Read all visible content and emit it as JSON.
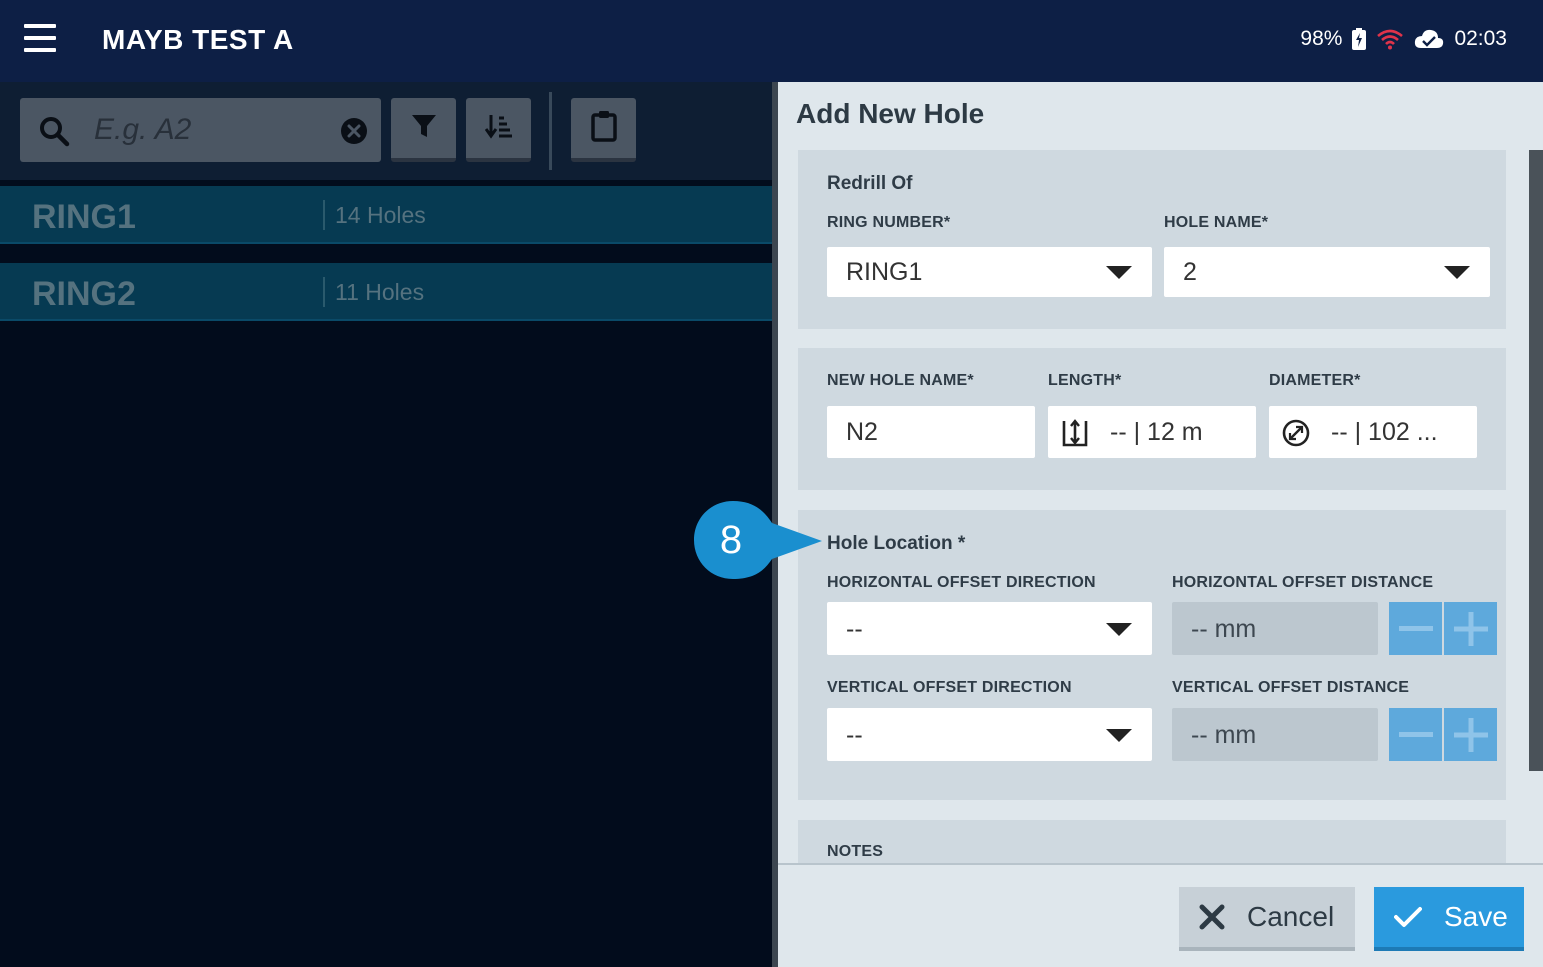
{
  "header": {
    "title": "MAYB TEST A",
    "battery": "98%",
    "time": "02:03"
  },
  "search": {
    "placeholder": "E.g. A2"
  },
  "rings": [
    {
      "name": "RING1",
      "count": "14 Holes"
    },
    {
      "name": "RING2",
      "count": "11 Holes"
    }
  ],
  "panel": {
    "title": "Add New Hole",
    "redrill": {
      "title": "Redrill Of",
      "ring_label": "RING NUMBER*",
      "ring_value": "RING1",
      "hole_label": "HOLE NAME*",
      "hole_value": "2"
    },
    "details": {
      "name_label": "NEW HOLE NAME*",
      "name_value": "N2",
      "length_label": "LENGTH*",
      "length_value": "-- | 12  m",
      "diameter_label": "DIAMETER*",
      "diameter_value": "-- | 102 ..."
    },
    "location": {
      "title": "Hole Location *",
      "h_dir_label": "HORIZONTAL OFFSET DIRECTION",
      "h_dir_value": "--",
      "h_dist_label": "HORIZONTAL OFFSET DISTANCE",
      "h_dist_value": "--  mm",
      "v_dir_label": "VERTICAL OFFSET DIRECTION",
      "v_dir_value": "--",
      "v_dist_label": "VERTICAL OFFSET DISTANCE",
      "v_dist_value": "--  mm"
    },
    "notes_label": "NOTES",
    "cancel_label": "Cancel",
    "save_label": "Save"
  },
  "callout": {
    "number": "8"
  },
  "colors": {
    "header_bg": "#0d1f45",
    "accent": "#2a9ade",
    "wifi": "#e0334a",
    "callout": "#1a8fcf"
  }
}
